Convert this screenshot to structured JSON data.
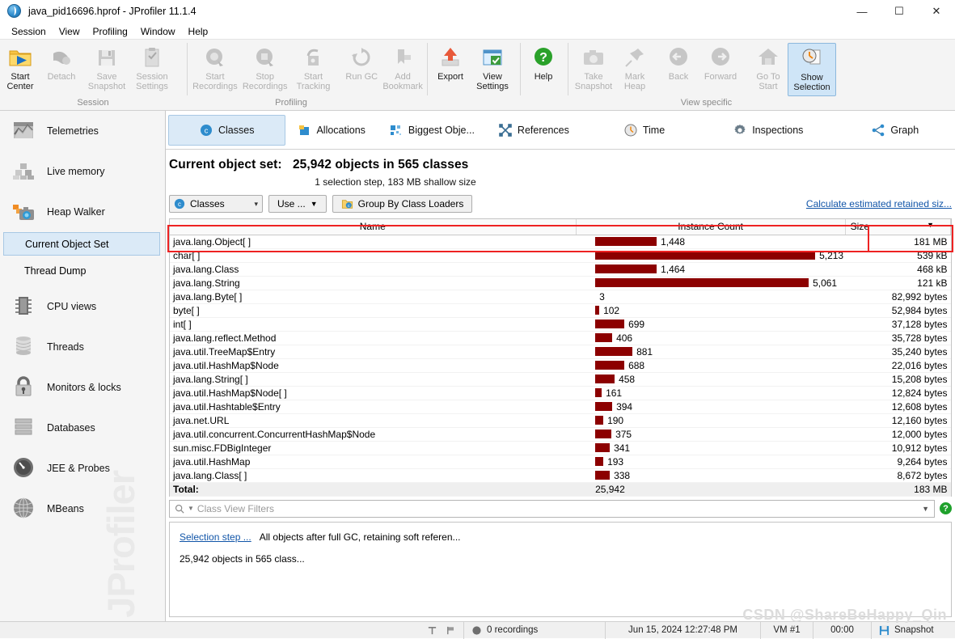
{
  "window": {
    "title": "java_pid16696.hprof - JProfiler 11.1.4",
    "icon": "jprofiler-globe-icon",
    "minimize": "—",
    "maximize": "☐",
    "close": "✕"
  },
  "menu": [
    "Session",
    "View",
    "Profiling",
    "Window",
    "Help"
  ],
  "ribbon": {
    "groups": [
      {
        "label": "Session",
        "buttons": [
          {
            "name": "start-center",
            "line1": "Start",
            "line2": "Center",
            "icon": "folder-play-icon",
            "enabled": true
          },
          {
            "name": "detach",
            "line1": "Detach",
            "line2": "",
            "icon": "detach-icon",
            "enabled": false
          },
          {
            "name": "save-snapshot",
            "line1": "Save",
            "line2": "Snapshot",
            "icon": "floppy-icon",
            "enabled": false
          },
          {
            "name": "session-settings",
            "line1": "Session",
            "line2": "Settings",
            "icon": "clipboard-icon",
            "enabled": false
          }
        ]
      },
      {
        "label": "Profiling",
        "buttons": [
          {
            "name": "start-recordings",
            "line1": "Start",
            "line2": "Recordings",
            "icon": "record-start-icon",
            "enabled": false
          },
          {
            "name": "stop-recordings",
            "line1": "Stop",
            "line2": "Recordings",
            "icon": "record-stop-icon",
            "enabled": false
          },
          {
            "name": "start-tracking",
            "line1": "Start",
            "line2": "Tracking",
            "icon": "tracking-icon",
            "enabled": false
          },
          {
            "name": "run-gc",
            "line1": "Run GC",
            "line2": "",
            "icon": "recycle-icon",
            "enabled": false
          },
          {
            "name": "add-bookmark",
            "line1": "Add",
            "line2": "Bookmark",
            "icon": "bookmark-icon",
            "enabled": false
          }
        ]
      },
      {
        "label": "",
        "buttons": [
          {
            "name": "export",
            "line1": "Export",
            "line2": "",
            "icon": "export-up-arrow-icon",
            "enabled": true
          },
          {
            "name": "view-settings",
            "line1": "View",
            "line2": "Settings",
            "icon": "window-check-icon",
            "enabled": true
          }
        ]
      },
      {
        "label": "",
        "buttons": [
          {
            "name": "help",
            "line1": "Help",
            "line2": "",
            "icon": "question-mark-icon",
            "enabled": true
          }
        ]
      },
      {
        "label": "View specific",
        "buttons": [
          {
            "name": "take-snapshot",
            "line1": "Take",
            "line2": "Snapshot",
            "icon": "camera-icon",
            "enabled": false
          },
          {
            "name": "mark-heap",
            "line1": "Mark",
            "line2": "Heap",
            "icon": "pin-icon",
            "enabled": false
          },
          {
            "name": "back",
            "line1": "Back",
            "line2": "",
            "icon": "arrow-left-circle-icon",
            "enabled": false
          },
          {
            "name": "forward",
            "line1": "Forward",
            "line2": "",
            "icon": "arrow-right-circle-icon",
            "enabled": false
          },
          {
            "name": "go-to-start",
            "line1": "Go To",
            "line2": "Start",
            "icon": "home-icon",
            "enabled": false
          },
          {
            "name": "show-selection",
            "line1": "Show",
            "line2": "Selection",
            "icon": "clock-doc-icon",
            "enabled": true,
            "selected": true
          }
        ]
      }
    ]
  },
  "sidebar": {
    "items": [
      {
        "label": "Telemetries",
        "icon": "telemetries-chart-icon",
        "type": "item"
      },
      {
        "label": "Live memory",
        "icon": "memory-blocks-icon",
        "type": "item"
      },
      {
        "label": "Heap Walker",
        "icon": "heap-walker-camera-icon",
        "type": "item"
      },
      {
        "label": "Current Object Set",
        "icon": "",
        "type": "sub",
        "active": true
      },
      {
        "label": "Thread Dump",
        "icon": "",
        "type": "sub",
        "active": false
      },
      {
        "label": "CPU views",
        "icon": "cpu-chip-icon",
        "type": "item"
      },
      {
        "label": "Threads",
        "icon": "thread-spool-icon",
        "type": "item"
      },
      {
        "label": "Monitors & locks",
        "icon": "padlock-icon",
        "type": "item"
      },
      {
        "label": "Databases",
        "icon": "database-icon",
        "type": "item"
      },
      {
        "label": "JEE & Probes",
        "icon": "gauge-icon",
        "type": "item"
      },
      {
        "label": "MBeans",
        "icon": "globe-grid-icon",
        "type": "item"
      }
    ],
    "watermark": "JProfiler"
  },
  "tabs": [
    {
      "label": "Classes",
      "icon": "classes-c-icon",
      "active": true
    },
    {
      "label": "Allocations",
      "icon": "allocations-icon",
      "active": false
    },
    {
      "label": "Biggest Obje...",
      "icon": "biggest-objects-icon",
      "active": false
    },
    {
      "label": "References",
      "icon": "references-icon",
      "active": false
    },
    {
      "label": "Time",
      "icon": "clock-icon",
      "active": false
    },
    {
      "label": "Inspections",
      "icon": "gear-icon",
      "active": false
    },
    {
      "label": "Graph",
      "icon": "graph-nodes-icon",
      "active": false
    }
  ],
  "header": {
    "title_prefix": "Current object set:",
    "title_value": "25,942 objects in 565 classes",
    "subtitle": "1 selection step, 183 MB shallow size"
  },
  "toolbar2": {
    "aggregation_value": "Classes",
    "aggregation_icon": "classes-c-icon",
    "use_label": "Use ...",
    "group_button_label": "Group By Class Loaders",
    "group_button_icon": "class-loaders-icon",
    "calculate_link": "Calculate estimated retained siz..."
  },
  "table": {
    "columns": [
      "Name",
      "Instance Count",
      "Size"
    ],
    "sort_column": "Size",
    "sort_indicator": "▼",
    "max_bar_count": 5213,
    "rows": [
      {
        "name": "java.lang.Object[ ]",
        "count": "1,448",
        "count_value": 1448,
        "bar": 1448,
        "size": "181 MB",
        "selected": true
      },
      {
        "name": "char[ ]",
        "count": "5,213",
        "count_value": 5213,
        "bar": 5213,
        "size": "539 kB"
      },
      {
        "name": "java.lang.Class",
        "count": "1,464",
        "count_value": 1464,
        "bar": 1464,
        "size": "468 kB"
      },
      {
        "name": "java.lang.String",
        "count": "5,061",
        "count_value": 5061,
        "bar": 5061,
        "size": "121 kB"
      },
      {
        "name": "java.lang.Byte[ ]",
        "count": "3",
        "count_value": 3,
        "bar": 3,
        "size": "82,992 bytes"
      },
      {
        "name": "byte[ ]",
        "count": "102",
        "count_value": 102,
        "bar": 102,
        "size": "52,984 bytes"
      },
      {
        "name": "int[ ]",
        "count": "699",
        "count_value": 699,
        "bar": 699,
        "size": "37,128 bytes"
      },
      {
        "name": "java.lang.reflect.Method",
        "count": "406",
        "count_value": 406,
        "bar": 406,
        "size": "35,728 bytes"
      },
      {
        "name": "java.util.TreeMap$Entry",
        "count": "881",
        "count_value": 881,
        "bar": 881,
        "size": "35,240 bytes"
      },
      {
        "name": "java.util.HashMap$Node",
        "count": "688",
        "count_value": 688,
        "bar": 688,
        "size": "22,016 bytes"
      },
      {
        "name": "java.lang.String[ ]",
        "count": "458",
        "count_value": 458,
        "bar": 458,
        "size": "15,208 bytes"
      },
      {
        "name": "java.util.HashMap$Node[ ]",
        "count": "161",
        "count_value": 161,
        "bar": 161,
        "size": "12,824 bytes"
      },
      {
        "name": "java.util.Hashtable$Entry",
        "count": "394",
        "count_value": 394,
        "bar": 394,
        "size": "12,608 bytes"
      },
      {
        "name": "java.net.URL",
        "count": "190",
        "count_value": 190,
        "bar": 190,
        "size": "12,160 bytes"
      },
      {
        "name": "java.util.concurrent.ConcurrentHashMap$Node",
        "count": "375",
        "count_value": 375,
        "bar": 375,
        "size": "12,000 bytes"
      },
      {
        "name": "sun.misc.FDBigInteger",
        "count": "341",
        "count_value": 341,
        "bar": 341,
        "size": "10,912 bytes"
      },
      {
        "name": "java.util.HashMap",
        "count": "193",
        "count_value": 193,
        "bar": 193,
        "size": "9,264 bytes"
      },
      {
        "name": "java.lang.Class[ ]",
        "count": "338",
        "count_value": 338,
        "bar": 338,
        "size": "8,672 bytes"
      }
    ],
    "total": {
      "name": "Total:",
      "count": "25,942",
      "size": "183 MB"
    }
  },
  "filter": {
    "placeholder": "Class View Filters",
    "icon": "search-icon",
    "help_badge": "?"
  },
  "selection_step": {
    "link": "Selection step ...",
    "description": "All objects after full GC, retaining soft referen...",
    "detail": "25,942 objects in 565 class..."
  },
  "statusbar": {
    "add_icon": "add-marker-icon",
    "flag_icon": "flag-icon",
    "recordings": "0 recordings",
    "timestamp": "Jun 15, 2024 12:27:48 PM",
    "vm": "VM #1",
    "elapsed": "00:00",
    "snapshot": "Snapshot",
    "snapshot_icon": "floppy-icon"
  },
  "watermark": "CSDN @ShareBeHappy_Qin",
  "colors": {
    "bar": "#8c0000",
    "accent_selected": "#dbeaf7",
    "annotation": "#ee2222",
    "link": "#1155a8"
  }
}
